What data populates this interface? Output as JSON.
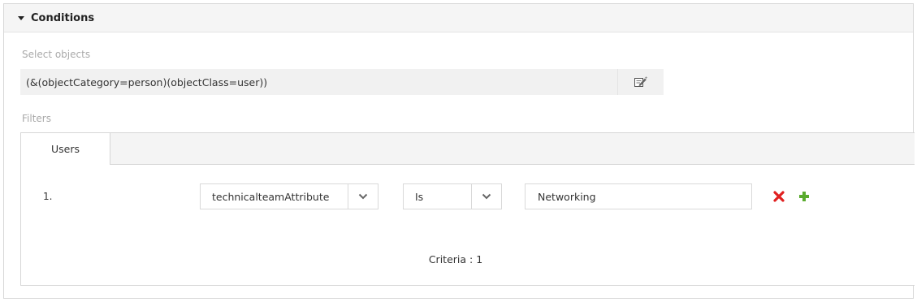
{
  "section": {
    "title": "Conditions"
  },
  "select_objects": {
    "label": "Select objects",
    "ldap_filter": "(&(objectCategory=person)(objectClass=user))"
  },
  "filters": {
    "label": "Filters",
    "tabs": [
      {
        "label": "Users",
        "active": true
      }
    ],
    "rows": [
      {
        "index": "1.",
        "attribute": "technicalteamAttribute",
        "operator": "Is",
        "value": "Networking"
      }
    ],
    "criteria_label": "Criteria : ",
    "criteria_count": "1"
  },
  "colors": {
    "remove": "#e02020",
    "add": "#5aab2e"
  },
  "icons": [
    "caret-down-icon",
    "edit-filter-icon",
    "chevron-down-icon",
    "remove-icon",
    "add-icon"
  ]
}
